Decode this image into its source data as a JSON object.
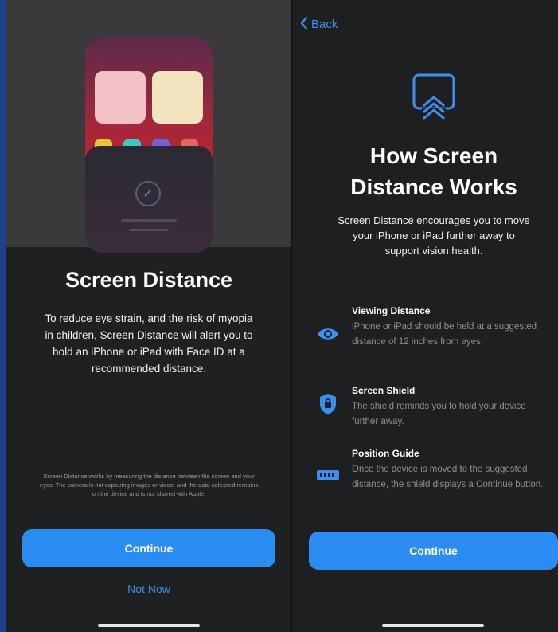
{
  "left": {
    "title": "Screen Distance",
    "description": "To reduce eye strain, and the risk of myopia in children, Screen Distance will alert you to hold an iPhone or iPad with Face ID at a recommended distance.",
    "fine_print": "Screen Distance works by measuring the distance between the screen and your eyes. The camera is not capturing images or video, and the data collected remains on the device and is not shared with Apple.",
    "continue_label": "Continue",
    "not_now_label": "Not Now",
    "illustration": {
      "check_glyph": "✓"
    }
  },
  "right": {
    "back_label": "Back",
    "back_icon": "chevron-left-icon",
    "hero_icon": "screen-distance-icon",
    "title": "How Screen Distance Works",
    "description": "Screen Distance encourages you to move your iPhone or iPad further away to support vision health.",
    "features": [
      {
        "icon": "eye-icon",
        "title": "Viewing Distance",
        "body": "iPhone or iPad should be held at a suggested distance of 12 inches from eyes."
      },
      {
        "icon": "shield-icon",
        "title": "Screen Shield",
        "body": "The shield reminds you to hold your device further away."
      },
      {
        "icon": "ruler-icon",
        "title": "Position Guide",
        "body": "Once the device is moved to the suggested distance, the shield displays a Continue button."
      }
    ],
    "continue_label": "Continue"
  },
  "colors": {
    "accent": "#2b8cf2",
    "link": "#3d8ef0",
    "background": "#1f2022"
  }
}
